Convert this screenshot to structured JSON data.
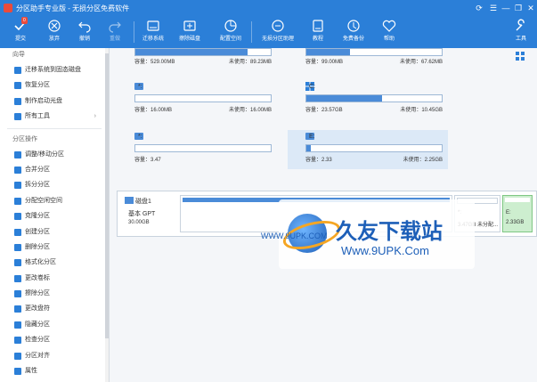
{
  "titlebar": {
    "title": "分区助手专业版 - 无损分区免费软件",
    "controls": [
      "⟳",
      "☰",
      "—",
      "❐",
      "✕"
    ]
  },
  "toolbar": {
    "submit": {
      "label": "提交",
      "badge": "0"
    },
    "discard": {
      "label": "放弃"
    },
    "undo": {
      "label": "撤销"
    },
    "redo": {
      "label": "重做"
    },
    "migrate": {
      "label": "迁移系统"
    },
    "wipe": {
      "label": "擦除磁盘"
    },
    "allocate": {
      "label": "配置空间"
    },
    "wizard": {
      "label": "无损分区助理"
    },
    "tutorial": {
      "label": "教程"
    },
    "backup": {
      "label": "免费备份"
    },
    "help": {
      "label": "帮助"
    },
    "tools": {
      "label": "工具"
    }
  },
  "sidebar": {
    "wizard_title": "向导",
    "wizard_items": [
      {
        "label": "迁移系统到固态磁盘",
        "icon": "monitor-icon"
      },
      {
        "label": "恢复分区",
        "icon": "recover-icon"
      },
      {
        "label": "制作启动光盘",
        "icon": "person-icon"
      },
      {
        "label": "所有工具",
        "icon": "tools-icon",
        "chevron": "›"
      }
    ],
    "ops_title": "分区操作",
    "ops_items": [
      {
        "label": "调整/移动分区",
        "icon": "resize-icon"
      },
      {
        "label": "合并分区",
        "icon": "merge-icon"
      },
      {
        "label": "拆分分区",
        "icon": "split-icon"
      },
      {
        "label": "分配空闲空间",
        "icon": "pie-icon"
      },
      {
        "label": "克隆分区",
        "icon": "clone-icon"
      },
      {
        "label": "创建分区",
        "icon": "create-icon"
      },
      {
        "label": "删除分区",
        "icon": "delete-icon"
      },
      {
        "label": "格式化分区",
        "icon": "format-icon"
      },
      {
        "label": "更改卷标",
        "icon": "label-icon"
      },
      {
        "label": "擦除分区",
        "icon": "eraser-icon"
      },
      {
        "label": "更改盘符",
        "icon": "pencil-icon"
      },
      {
        "label": "隐藏分区",
        "icon": "hide-icon"
      },
      {
        "label": "检查分区",
        "icon": "check-icon"
      },
      {
        "label": "分区对齐",
        "icon": "align-icon"
      },
      {
        "label": "属性",
        "icon": "info-icon"
      }
    ]
  },
  "partitions": [
    {
      "id": "p1",
      "name": "",
      "cap": "容量：529.00MB",
      "free": "未使用：89.23MB",
      "fill": 0.83,
      "top_bar": true
    },
    {
      "id": "p2",
      "name": "",
      "cap": "容量：99.00MB",
      "free": "未使用：67.62MB",
      "fill": 0.32,
      "top_bar": true
    },
    {
      "id": "p3",
      "name": "*:",
      "cap": "容量：16.00MB",
      "free": "未使用：16.00MB",
      "fill": 0.0
    },
    {
      "id": "p4",
      "name": "C:",
      "cap": "容量：23.57GB",
      "free": "未使用：10.45GB",
      "fill": 0.56,
      "windows": true
    },
    {
      "id": "p5",
      "name": "*:",
      "cap": "容量：3.47",
      "free": "",
      "fill": 0.0
    },
    {
      "id": "p6",
      "name": "E:",
      "cap": "容量：2.33",
      "free": "未使用：2.25GB",
      "fill": 0.03
    }
  ],
  "disk": {
    "name": "磁盘1",
    "type": "基本 GPT",
    "size": "30.00GB",
    "segments": [
      {
        "name": "",
        "size": ""
      },
      {
        "name": "*:",
        "size": "3.47GB 未分配..."
      },
      {
        "name": "E:",
        "size": "2.33GB"
      }
    ]
  },
  "watermark": {
    "cn": "久友下载站",
    "url_small": "WWW.9UPK.COM",
    "url_big": "Www.9UPK.Com"
  }
}
